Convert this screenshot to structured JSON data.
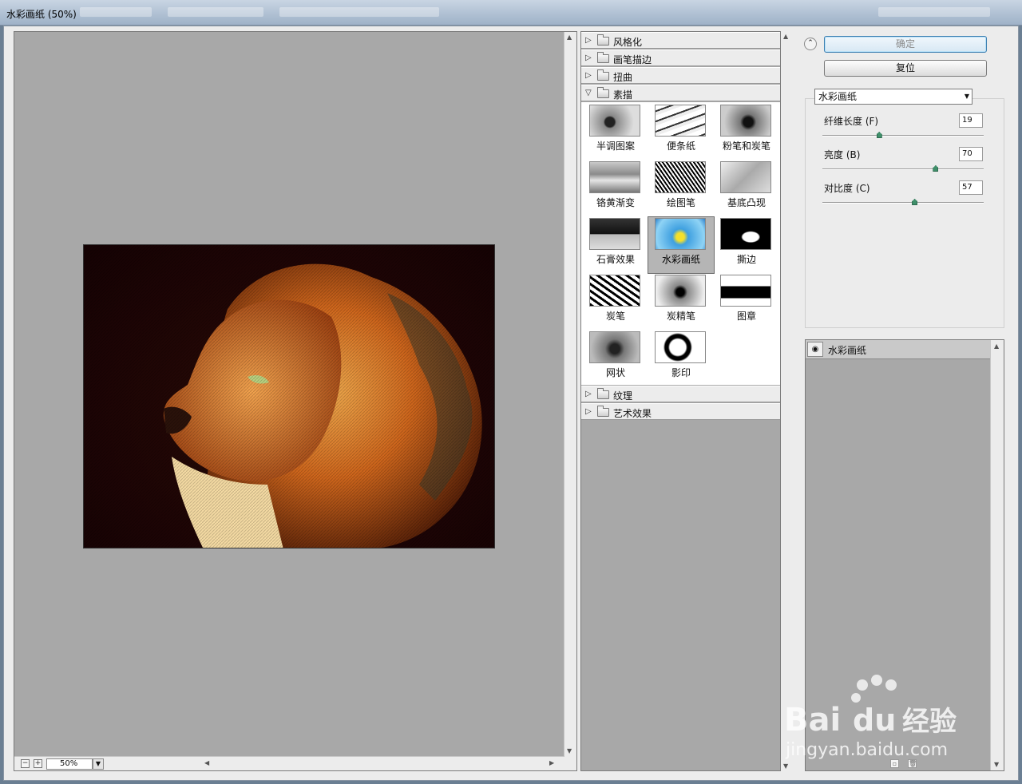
{
  "window": {
    "title": "水彩画纸 (50%)"
  },
  "preview": {
    "zoom_value": "50%"
  },
  "gallery": {
    "categories_top": [
      "风格化",
      "画笔描边",
      "扭曲"
    ],
    "open_category": "素描",
    "thumbnails": [
      {
        "label": "半调图案"
      },
      {
        "label": "便条纸"
      },
      {
        "label": "粉笔和炭笔"
      },
      {
        "label": "铬黄渐变"
      },
      {
        "label": "绘图笔"
      },
      {
        "label": "基底凸现"
      },
      {
        "label": "石膏效果"
      },
      {
        "label": "水彩画纸"
      },
      {
        "label": "撕边"
      },
      {
        "label": "炭笔"
      },
      {
        "label": "炭精笔"
      },
      {
        "label": "图章"
      },
      {
        "label": "网状"
      },
      {
        "label": "影印"
      }
    ],
    "selected": "水彩画纸",
    "categories_bottom": [
      "纹理",
      "艺术效果"
    ]
  },
  "actions": {
    "ok_label": "确定",
    "reset_label": "复位"
  },
  "settings": {
    "filter_select": "水彩画纸",
    "params": [
      {
        "label": "纤维长度 (F)",
        "value": "19",
        "fraction": 0.35
      },
      {
        "label": "亮度 (B)",
        "value": "70",
        "fraction": 0.7
      },
      {
        "label": "对比度 (C)",
        "value": "57",
        "fraction": 0.57
      }
    ]
  },
  "layers": {
    "items": [
      {
        "label": "水彩画纸"
      }
    ]
  },
  "watermark": {
    "brand": "Bai",
    "brand2": "du",
    "suffix": "经验",
    "url": "jingyan.baidu.com"
  },
  "colors": {
    "accent": "#3c7fb1",
    "panel": "#ececec",
    "canvas": "#a8a8a8"
  }
}
